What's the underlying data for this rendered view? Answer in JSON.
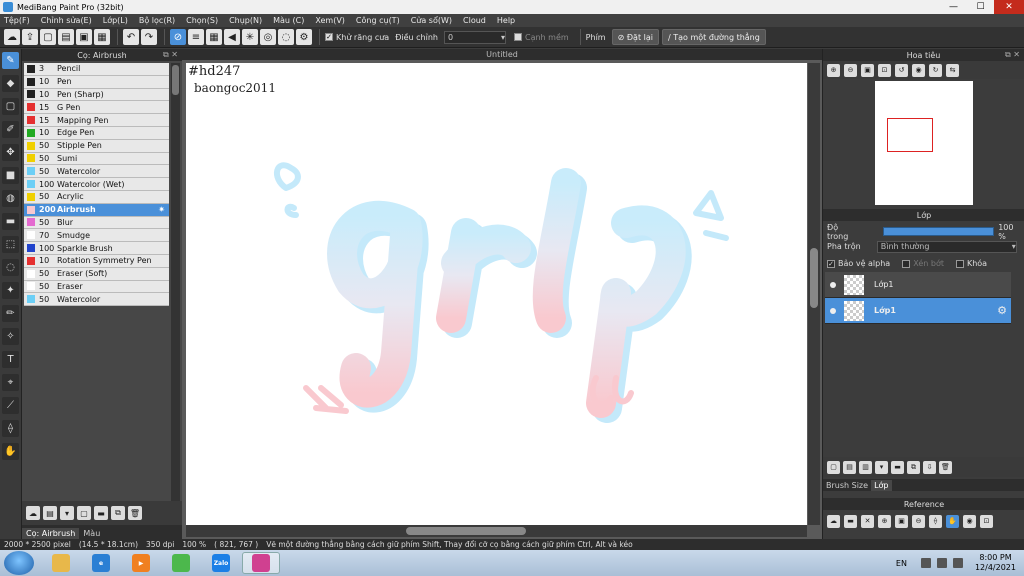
{
  "window": {
    "title": "MediBang Paint Pro (32bit)"
  },
  "menu": [
    "Tệp(F)",
    "Chỉnh sửa(E)",
    "Lớp(L)",
    "Bộ lọc(R)",
    "Chọn(S)",
    "Chụp(N)",
    "Màu (C)",
    "Xem(V)",
    "Công cụ(T)",
    "Cửa sổ(W)",
    "Cloud",
    "Help"
  ],
  "toolbar": {
    "antialias_label": "Khử răng cưa",
    "correction_label": "Điều chỉnh",
    "correction_value": "0",
    "edge_label": "Cạnh mềm",
    "snap_label": "Phím",
    "reset_label": "Đặt lại",
    "line_label": "Tạo một đường thẳng"
  },
  "brush_panel": {
    "title": "Cọ: Airbrush",
    "brushes": [
      {
        "size": "3",
        "name": "Pencil",
        "color": "#222222"
      },
      {
        "size": "10",
        "name": "Pen",
        "color": "#222222"
      },
      {
        "size": "10",
        "name": "Pen (Sharp)",
        "color": "#222222"
      },
      {
        "size": "15",
        "name": "G Pen",
        "color": "#e53030"
      },
      {
        "size": "15",
        "name": "Mapping Pen",
        "color": "#e53030"
      },
      {
        "size": "10",
        "name": "Edge Pen",
        "color": "#22aa22"
      },
      {
        "size": "50",
        "name": "Stipple Pen",
        "color": "#f0d000"
      },
      {
        "size": "50",
        "name": "Sumi",
        "color": "#f0d000"
      },
      {
        "size": "50",
        "name": "Watercolor",
        "color": "#6ccff6"
      },
      {
        "size": "100",
        "name": "Watercolor (Wet)",
        "color": "#6ccff6"
      },
      {
        "size": "50",
        "name": "Acrylic",
        "color": "#f0d000"
      },
      {
        "size": "200",
        "name": "Airbrush",
        "color": "#f7c8d0",
        "selected": true
      },
      {
        "size": "50",
        "name": "Blur",
        "color": "#e46ad0"
      },
      {
        "size": "70",
        "name": "Smudge",
        "color": "#ffffff"
      },
      {
        "size": "100",
        "name": "Sparkle Brush",
        "color": "#2244cc"
      },
      {
        "size": "10",
        "name": "Rotation Symmetry Pen",
        "color": "#e53030"
      },
      {
        "size": "50",
        "name": "Eraser (Soft)",
        "color": "#ffffff"
      },
      {
        "size": "50",
        "name": "Eraser",
        "color": "#ffffff"
      },
      {
        "size": "50",
        "name": "Watercolor",
        "color": "#6ccff6"
      }
    ],
    "tabs": [
      "Cọ: Airbrush",
      "Màu"
    ]
  },
  "document": {
    "tab_title": "Untitled",
    "text_line1": "#hd247",
    "text_line2": "baongoc2011"
  },
  "navigator": {
    "title": "Hoa tiêu"
  },
  "layer_panel": {
    "title": "Lớp",
    "opacity_label": "Độ trong",
    "opacity_value": "100 %",
    "opacity_fraction": 1.0,
    "blend_label": "Pha trộn",
    "blend_value": "Bình thường",
    "protect_alpha_label": "Bảo vệ alpha",
    "clipping_label": "Xén bớt",
    "lock_label": "Khóa",
    "layers": [
      {
        "name": "Lớp1",
        "selected": false
      },
      {
        "name": "Lớp1",
        "selected": true
      }
    ],
    "tabs": [
      "Brush Size",
      "Lớp"
    ]
  },
  "reference": {
    "title": "Reference"
  },
  "status": {
    "size": "2000 * 2500 pixel",
    "physical": "(14.5 * 18.1cm)",
    "dpi": "350 dpi",
    "zoom": "100 %",
    "cursor": "( 821, 767 )",
    "hint": "Vẽ một đường thẳng bằng cách giữ phím Shift, Thay đổi cỡ cọ bằng cách giữ phím Ctrl, Alt và kéo"
  },
  "taskbar": {
    "apps": [
      {
        "name": "folder-app",
        "color": "#e8b84a",
        "label": ""
      },
      {
        "name": "ie-app",
        "color": "#2a7fd4",
        "label": "e"
      },
      {
        "name": "media-app",
        "color": "#f08020",
        "label": "▶"
      },
      {
        "name": "green-app",
        "color": "#4cb84c",
        "label": ""
      },
      {
        "name": "zalo-app",
        "color": "#1b7fe6",
        "label": "Zalo"
      },
      {
        "name": "medibang-app",
        "color": "#d04090",
        "label": ""
      }
    ],
    "lang": "EN",
    "time": "8:00 PM",
    "date": "12/4/2021"
  }
}
